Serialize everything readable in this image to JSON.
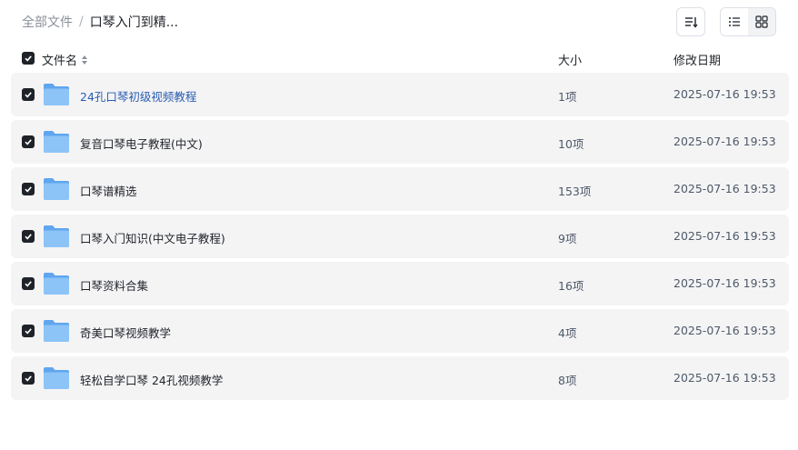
{
  "breadcrumb": {
    "root": "全部文件",
    "separator": "/",
    "current": "口琴入门到精..."
  },
  "toolbar": {
    "sort_icon": "sort-icon",
    "list_view_icon": "list-view-icon",
    "grid_view_icon": "grid-view-icon",
    "active_view": "list"
  },
  "table": {
    "headers": {
      "name": "文件名",
      "size": "大小",
      "date": "修改日期"
    },
    "rows": [
      {
        "name": "24孔口琴初级视频教程",
        "size": "1项",
        "date": "2025-07-16 19:53",
        "checked": true,
        "highlight": true
      },
      {
        "name": "复音口琴电子教程(中文)",
        "size": "10项",
        "date": "2025-07-16 19:53",
        "checked": true,
        "highlight": false
      },
      {
        "name": "口琴谱精选",
        "size": "153项",
        "date": "2025-07-16 19:53",
        "checked": true,
        "highlight": false
      },
      {
        "name": "口琴入门知识(中文电子教程)",
        "size": "9项",
        "date": "2025-07-16 19:53",
        "checked": true,
        "highlight": false
      },
      {
        "name": "口琴资料合集",
        "size": "16项",
        "date": "2025-07-16 19:53",
        "checked": true,
        "highlight": false
      },
      {
        "name": "奇美口琴视频教学",
        "size": "4项",
        "date": "2025-07-16 19:53",
        "checked": true,
        "highlight": false
      },
      {
        "name": "轻松自学口琴 24孔视频教学",
        "size": "8项",
        "date": "2025-07-16 19:53",
        "checked": true,
        "highlight": false
      }
    ]
  },
  "colors": {
    "link": "#2a5db0",
    "row_bg": "#f4f4f5",
    "checkbox": "#1f2329",
    "folder": "#7ab8f5"
  }
}
